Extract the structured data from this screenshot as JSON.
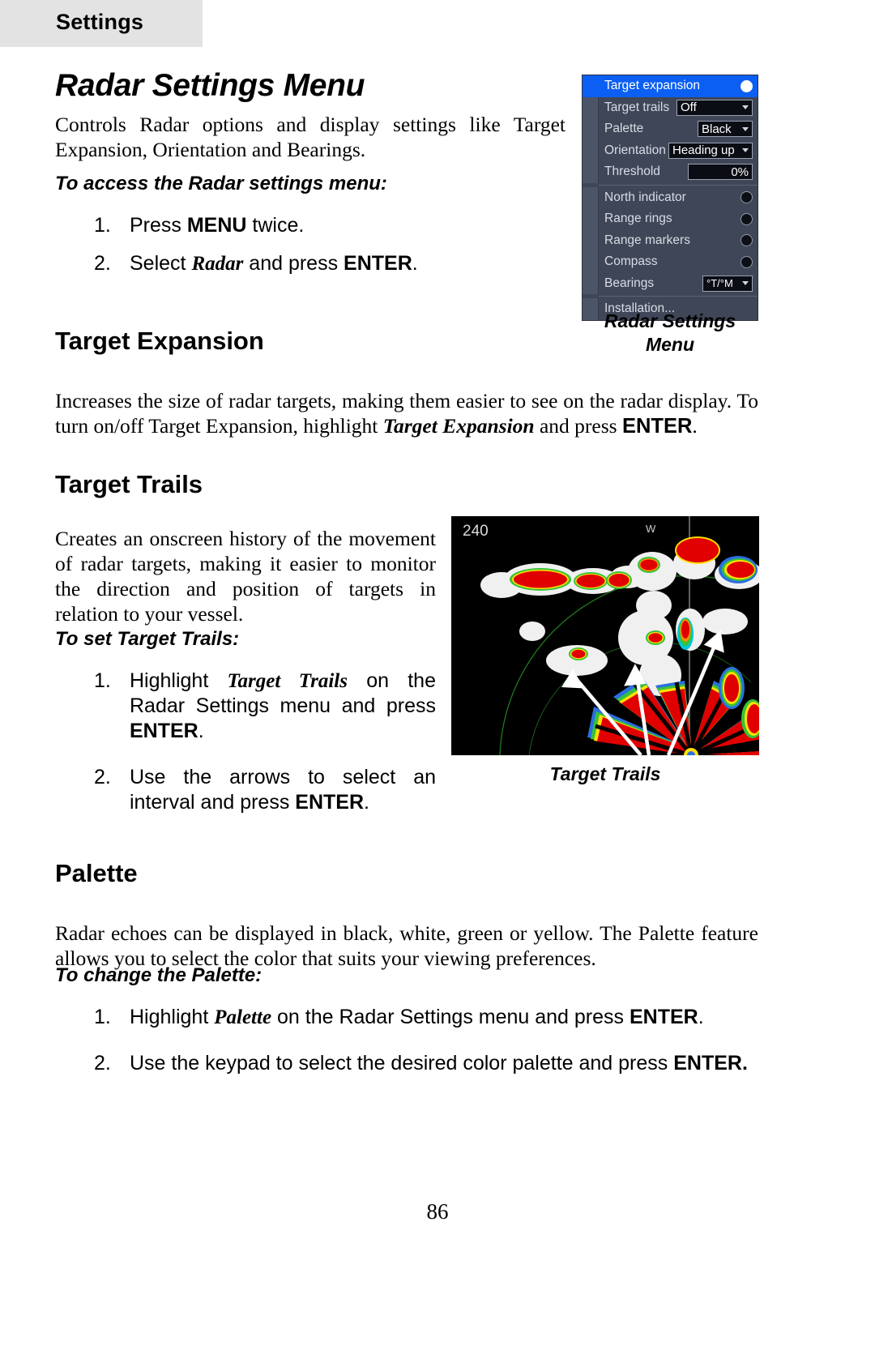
{
  "header": {
    "tab_label": "Settings"
  },
  "page_number": "86",
  "sections": {
    "radar_settings_menu": {
      "title": "Radar Settings Menu",
      "intro": "Controls Radar options and display settings like Target Expansion, Orientation and Bearings.",
      "procedure_title": "To access the Radar settings menu:",
      "steps": [
        {
          "num": "1.",
          "prefix": "Press ",
          "bold": "MENU",
          "suffix": " twice."
        },
        {
          "num": "2.",
          "prefix": "Select ",
          "italic": "Radar",
          "mid": " and press ",
          "bold": "ENTER",
          "suffix": "."
        }
      ]
    },
    "target_expansion": {
      "title": "Target Expansion",
      "body_part1": "Increases the size of radar targets, making them easier to see on the radar display. To turn on/off Target Expansion, highlight ",
      "body_italic": "Target Expansion",
      "body_part2": " and press ",
      "body_bold": "ENTER",
      "body_part3": "."
    },
    "target_trails": {
      "title": "Target Trails",
      "body": "Creates an onscreen history of the movement of radar targets, making it easier to monitor the direction and position of targets in relation to your vessel.",
      "procedure_title": "To set Target Trails:",
      "steps": [
        {
          "num": "1.",
          "prefix": "Highlight ",
          "italic": "Target Trails",
          "mid": " on the Radar Settings menu and press ",
          "bold": "ENTER",
          "suffix": "."
        },
        {
          "num": "2.",
          "prefix": "Use the arrows to select an interval and press ",
          "bold": "ENTER",
          "suffix": "."
        }
      ]
    },
    "palette": {
      "title": "Palette",
      "body": "Radar echoes can be displayed in black, white, green or yellow. The Palette feature allows you to select the color that suits your viewing preferences.",
      "procedure_title": "To change the Palette:",
      "steps": [
        {
          "num": "1.",
          "prefix": "Highlight ",
          "italic": "Palette",
          "mid": " on the Radar Settings menu and press ",
          "bold": "ENTER",
          "suffix": "."
        },
        {
          "num": "2.",
          "prefix": "Use the keypad to select the desired color palette and press ",
          "bold": "ENTER.",
          "suffix": ""
        }
      ]
    }
  },
  "figures": {
    "radar_menu": {
      "caption_line1": "Radar Settings",
      "caption_line2": "Menu",
      "rows": [
        {
          "label": "Target expansion",
          "control": "dot",
          "selected": true
        },
        {
          "label": "Target trails",
          "control": "combo",
          "value": "Off"
        },
        {
          "label": "Palette",
          "control": "combo",
          "value": "Black"
        },
        {
          "label": "Orientation",
          "control": "combo",
          "value": "Heading up"
        },
        {
          "label": "Threshold",
          "control": "field",
          "value": "0%"
        },
        {
          "label": "North indicator",
          "control": "dot"
        },
        {
          "label": "Range rings",
          "control": "dot"
        },
        {
          "label": "Range markers",
          "control": "dot"
        },
        {
          "label": "Compass",
          "control": "dot"
        },
        {
          "label": "Bearings",
          "control": "combo",
          "value": "°T/°M"
        },
        {
          "label": "Installation...",
          "control": "none"
        }
      ]
    },
    "target_trails_image": {
      "caption": "Target Trails",
      "range_label": "240"
    }
  },
  "colors": {
    "menu_background": "#3f4657",
    "menu_highlight": "#0b5ff2",
    "tab_background": "#e3e3e3",
    "radar_echo_red": "#e00000",
    "radar_ring_green": "#1f7a1f"
  }
}
